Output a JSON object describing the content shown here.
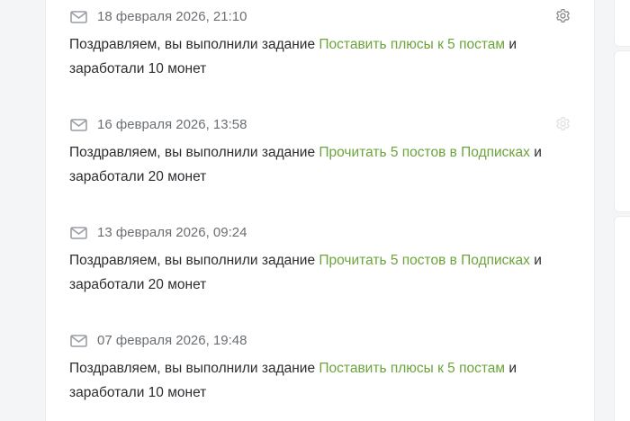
{
  "notifications": [
    {
      "date": "18 февраля 2026, 21:10",
      "prefix": "Поздравляем, вы выполнили задание",
      "task": "Поставить плюсы к 5 постам",
      "conj": "и",
      "suffix": "заработали 10 монет"
    },
    {
      "date": "16 февраля 2026, 13:58",
      "prefix": "Поздравляем, вы выполнили задание",
      "task": "Прочитать 5 постов в Подписках",
      "conj": "и",
      "suffix": "заработали 20 монет"
    },
    {
      "date": "13 февраля 2026, 09:24",
      "prefix": "Поздравляем, вы выполнили задание",
      "task": "Прочитать 5 постов в Подписках",
      "conj": "и",
      "suffix": "заработали 20 монет"
    },
    {
      "date": "07 февраля 2026, 19:48",
      "prefix": "Поздравляем, вы выполнили задание",
      "task": "Поставить плюсы к 5 постам",
      "conj": "и",
      "suffix": "заработали 10 монет"
    }
  ],
  "icons": {
    "mail": "mail-icon",
    "settings": "gear-icon"
  },
  "colors": {
    "link": "#6ba43a",
    "text": "#2b2d30",
    "date": "#6b6f73",
    "icon": "#9a9ea3"
  }
}
